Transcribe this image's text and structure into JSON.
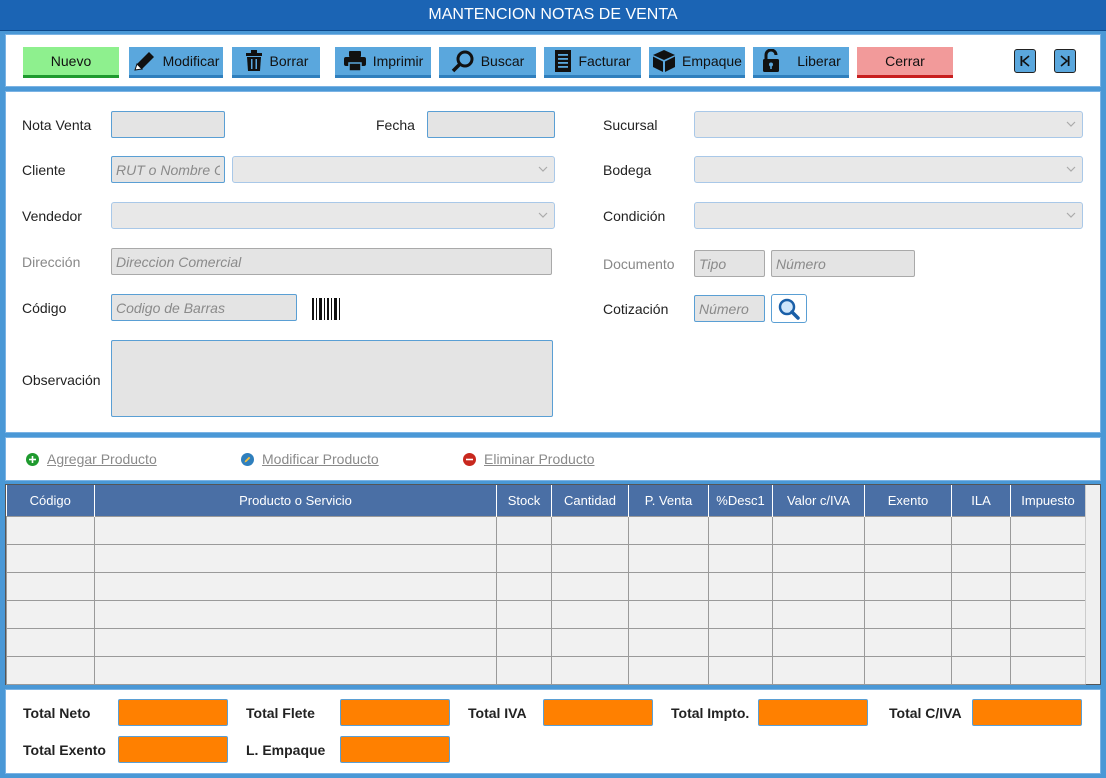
{
  "window": {
    "title": "MANTENCION NOTAS DE VENTA"
  },
  "toolbar": {
    "nuevo": "Nuevo",
    "modificar": "Modificar",
    "borrar": "Borrar",
    "imprimir": "Imprimir",
    "buscar": "Buscar",
    "facturar": "Facturar",
    "empaque": "Empaque",
    "liberar": "Liberar",
    "cerrar": "Cerrar",
    "colors": {
      "primary": "#5aa7dd",
      "nuevo": "#8ef08e",
      "cerrar": "#f29a9a"
    }
  },
  "form": {
    "nota_venta": {
      "label": "Nota Venta",
      "value": ""
    },
    "fecha": {
      "label": "Fecha",
      "value": ""
    },
    "cliente": {
      "label": "Cliente",
      "placeholder": "RUT o Nombre Cliente",
      "selected": ""
    },
    "vendedor": {
      "label": "Vendedor",
      "selected": ""
    },
    "direccion": {
      "label": "Dirección",
      "placeholder": "Direccion Comercial"
    },
    "codigo": {
      "label": "Código",
      "placeholder": "Codigo de Barras",
      "icon": "barcode-icon"
    },
    "observacion": {
      "label": "Observación",
      "value": ""
    },
    "sucursal": {
      "label": "Sucursal",
      "selected": ""
    },
    "bodega": {
      "label": "Bodega",
      "selected": ""
    },
    "condicion": {
      "label": "Condición",
      "selected": ""
    },
    "documento": {
      "label": "Documento",
      "tipo_placeholder": "Tipo",
      "numero_placeholder": "Número"
    },
    "cotizacion": {
      "label": "Cotización",
      "numero_placeholder": "Número",
      "icon": "search-icon"
    }
  },
  "actions": {
    "agregar": "Agregar Producto",
    "modificar": "Modificar Producto",
    "eliminar": "Eliminar Producto"
  },
  "grid": {
    "columns": [
      "Código",
      "Producto o Servicio",
      "Stock",
      "Cantidad",
      "P. Venta",
      "%Desc1",
      "Valor c/IVA",
      "Exento",
      "ILA",
      "Impuesto"
    ],
    "empty_rows": 6
  },
  "totals": {
    "total_neto": "Total Neto",
    "total_flete": "Total Flete",
    "total_iva": "Total IVA",
    "total_impto": "Total Impto.",
    "total_civa": "Total C/IVA",
    "total_exento": "Total Exento",
    "l_empaque": "L. Empaque",
    "box_color": "#ff8000"
  }
}
